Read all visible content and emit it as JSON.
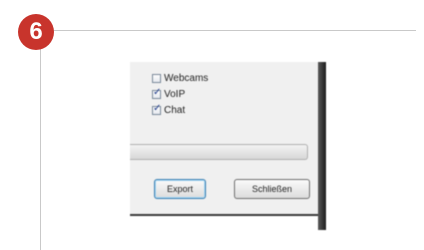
{
  "step": {
    "number": "6"
  },
  "dialog": {
    "checkboxes": [
      {
        "label": "Webcams",
        "checked": false
      },
      {
        "label": "VoIP",
        "checked": true
      },
      {
        "label": "Chat",
        "checked": true
      }
    ],
    "buttons": {
      "export_label": "Export",
      "close_label": "Schließen"
    }
  },
  "colors": {
    "badge": "#c8342c",
    "frame_line": "#c9c9c9",
    "button_focus": "#3c7fb1"
  }
}
